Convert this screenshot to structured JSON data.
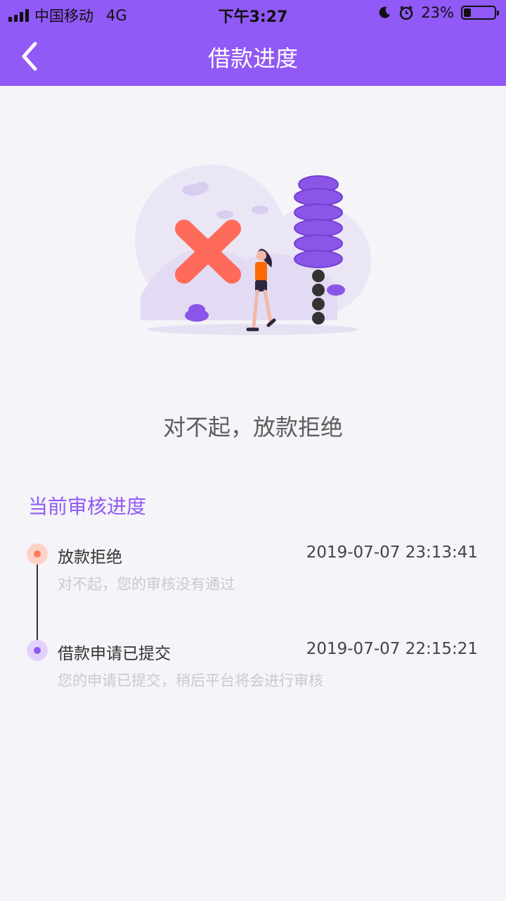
{
  "status_bar": {
    "carrier": "中国移动",
    "network": "4G",
    "time": "下午3:27",
    "battery": "23%",
    "battery_level": 0.23
  },
  "nav": {
    "title": "借款进度",
    "back_icon": "chevron-left-icon"
  },
  "result": {
    "message": "对不起，放款拒绝",
    "illustration": "rejection-illustration"
  },
  "progress": {
    "section_title": "当前审核进度",
    "items": [
      {
        "title": "放款拒绝",
        "time": "2019-07-07 23:13:41",
        "description": "对不起，您的审核没有通过",
        "dot_color": "#ff7a5a",
        "dot_bg": "#ffd2c7"
      },
      {
        "title": "借款申请已提交",
        "time": "2019-07-07 22:15:21",
        "description": "您的申请已提交，稍后平台将会进行审核",
        "dot_color": "#9159f6",
        "dot_bg": "#e1d2fb"
      }
    ]
  },
  "colors": {
    "accent": "#9159f6",
    "background": "#f4f4f9",
    "reject": "#ff6b5b"
  }
}
